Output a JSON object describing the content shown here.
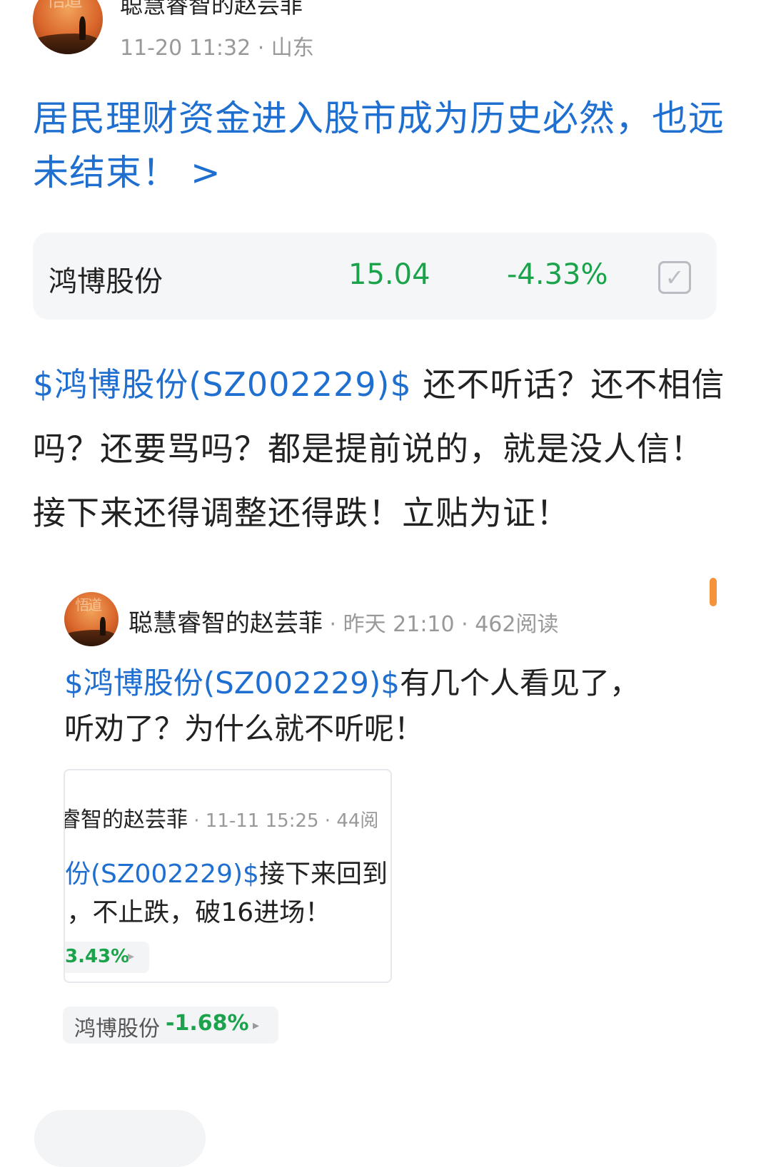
{
  "header": {
    "author": "聪慧睿智的赵芸菲",
    "meta": "11-20 11:32 · 山东",
    "avatar_seal": "悟道"
  },
  "title": "居民理财资金进入股市成为历史必然，也远未结束！ >",
  "stock_card": {
    "name": "鸿博股份",
    "price": "15.04",
    "change": "-4.33%",
    "check_icon": "✓"
  },
  "post": {
    "mention": "$鸿博股份(SZ002229)$",
    "text": " 还不听话？还不相信吗？还要骂吗？都是提前说的，就是没人信！接下来还得调整还得跌！立贴为证！"
  },
  "quoted": {
    "author": "聪慧睿智的赵芸菲",
    "meta": " · 昨天 21:10 · 462阅读",
    "mention": "$鸿博股份(SZ002229)$",
    "text": "有几个人看见了，听劝了？为什么就不听呢！",
    "avatar_seal": "悟道",
    "nested": {
      "author": "睿智的赵芸菲",
      "meta": " · 11-11 15:25 · 44阅",
      "mention": "份(SZ002229)$",
      "text1": "接下来回到",
      "text2": "‹，不止跌，破16进场！",
      "chip_change": "3.43%",
      "chip_arrow": "▸"
    },
    "chip": {
      "name": "鸿博股份",
      "change": "-1.68%",
      "arrow": "▸"
    }
  },
  "colors": {
    "link": "#1f6fd1",
    "down": "#1aa34a",
    "accent": "#f5933a"
  }
}
